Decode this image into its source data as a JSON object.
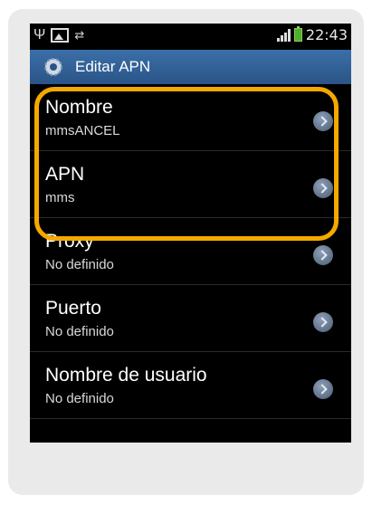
{
  "status_bar": {
    "time": "22:43",
    "icons": [
      "usb-icon",
      "gallery-icon",
      "sync-icon",
      "signal-icon",
      "battery-icon"
    ]
  },
  "title_bar": {
    "title": "Editar APN",
    "icon": "gear-icon"
  },
  "list": [
    {
      "title": "Nombre",
      "subtitle": "mmsANCEL"
    },
    {
      "title": "APN",
      "subtitle": "mms"
    },
    {
      "title": "Proxy",
      "subtitle": "No definido"
    },
    {
      "title": "Puerto",
      "subtitle": "No definido"
    },
    {
      "title": "Nombre de usuario",
      "subtitle": "No definido"
    }
  ],
  "colors": {
    "highlight": "#f5a800",
    "titlebar": "#2f5f99",
    "background": "#000000"
  }
}
